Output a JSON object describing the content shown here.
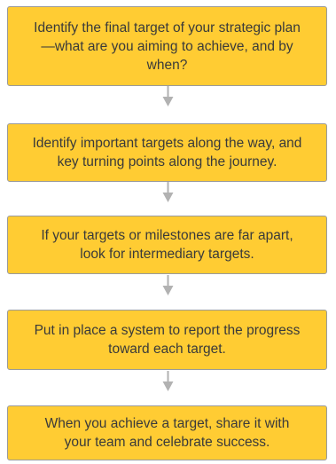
{
  "diagram": {
    "type": "vertical-flowchart",
    "box_fill": "#ffcc33",
    "box_border": "#9a9a9a",
    "text_color": "#3a3a3a",
    "arrow_color": "#b2b2b2",
    "steps": [
      {
        "text": "Identify the final target of your strategic plan—what are you aiming to achieve, and by when?"
      },
      {
        "text": "Identify important targets along the way, and key turning points along the journey."
      },
      {
        "text": "If your targets or milestones are far apart, look for intermediary targets."
      },
      {
        "text": "Put in place a system to report the progress toward each target."
      },
      {
        "text": "When you achieve a target, share it with your team and celebrate success."
      }
    ]
  }
}
